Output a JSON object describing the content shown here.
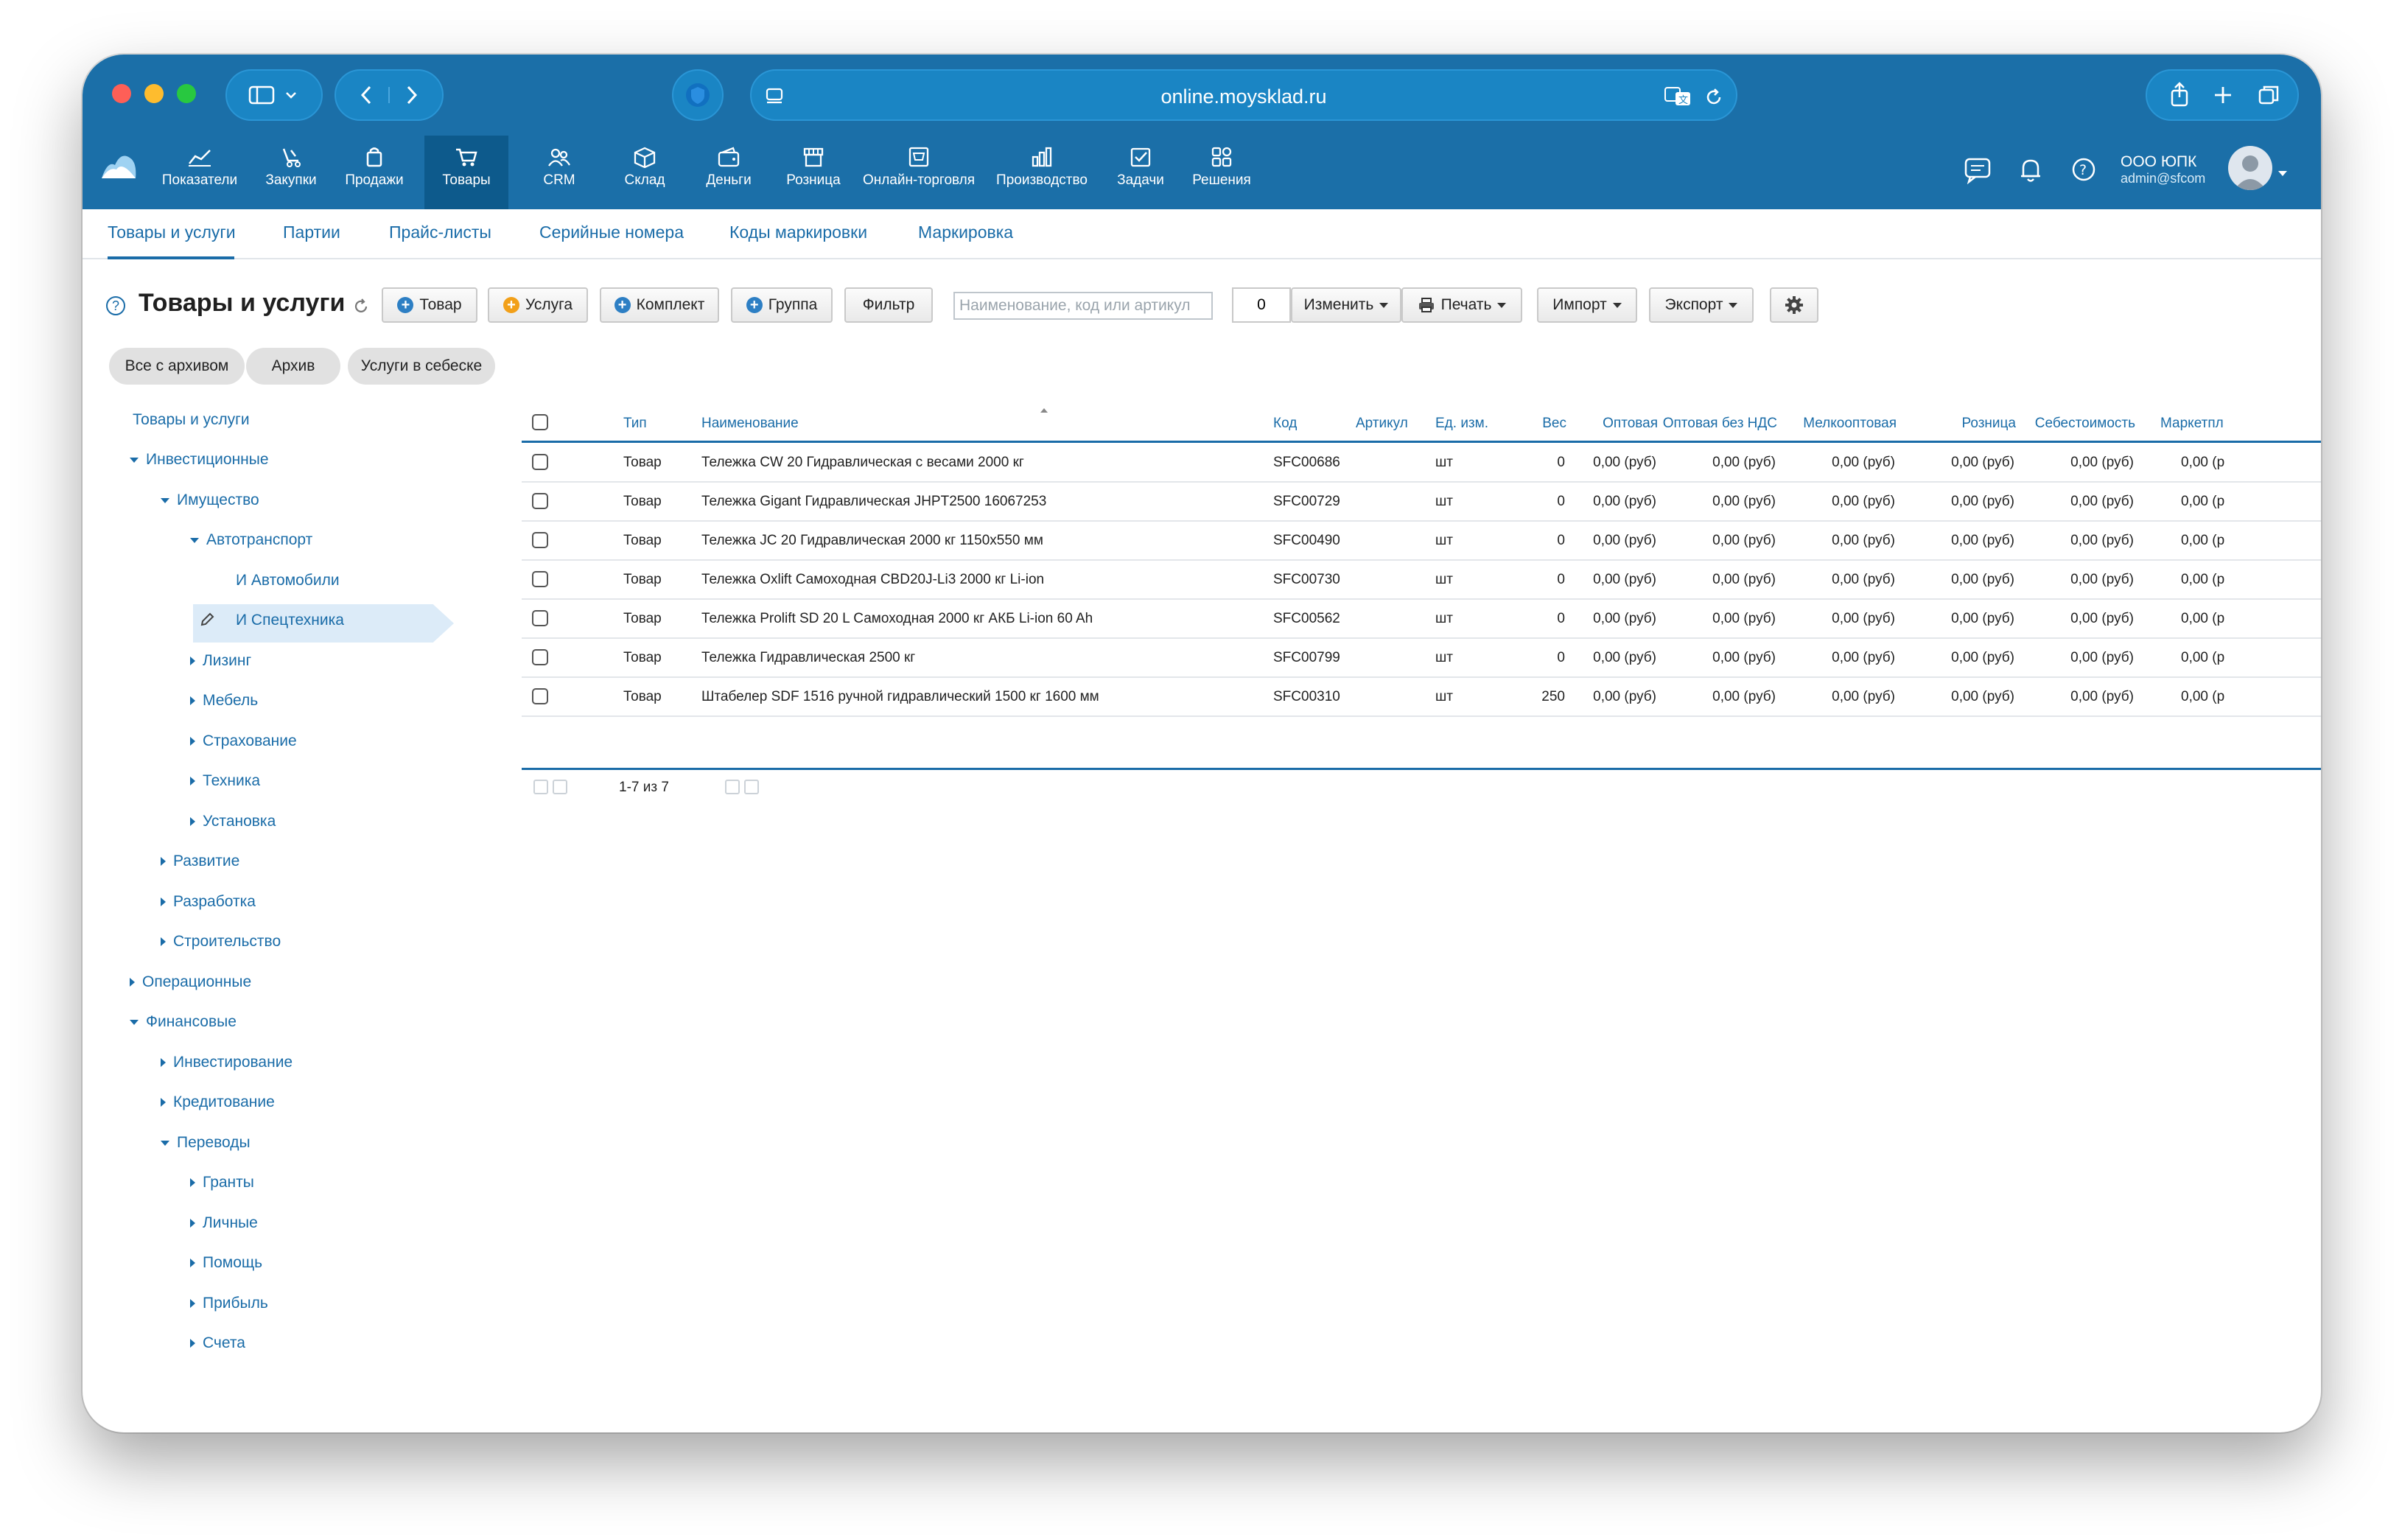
{
  "browser": {
    "url": "online.moysklad.ru"
  },
  "app_nav": {
    "items": [
      {
        "label": "Показатели",
        "icon": "chart-icon"
      },
      {
        "label": "Закупки",
        "icon": "purchase-icon"
      },
      {
        "label": "Продажи",
        "icon": "bag-icon"
      },
      {
        "label": "Товары",
        "icon": "cart-icon"
      },
      {
        "label": "CRM",
        "icon": "people-icon"
      },
      {
        "label": "Склад",
        "icon": "box-icon"
      },
      {
        "label": "Деньги",
        "icon": "wallet-icon"
      },
      {
        "label": "Розница",
        "icon": "store-icon"
      },
      {
        "label": "Онлайн-торговля",
        "icon": "online-store-icon"
      },
      {
        "label": "Производство",
        "icon": "production-icon"
      },
      {
        "label": "Задачи",
        "icon": "tasks-icon"
      },
      {
        "label": "Решения",
        "icon": "apps-icon"
      }
    ],
    "active": "Товары",
    "org_name": "ООО ЮПК",
    "user": "admin@sfcom"
  },
  "subnav": {
    "items": [
      "Товары и услуги",
      "Партии",
      "Прайс-листы",
      "Серийные номера",
      "Коды маркировки",
      "Маркировка"
    ],
    "active": "Товары и услуги"
  },
  "toolbar": {
    "title": "Товары и услуги",
    "product_label": "Товар",
    "service_label": "Услуга",
    "kit_label": "Комплект",
    "group_label": "Группа",
    "filter_label": "Фильтр",
    "search_placeholder": "Наименование, код или артикул",
    "selected_count": "0",
    "edit_label": "Изменить",
    "print_label": "Печать",
    "import_label": "Импорт",
    "export_label": "Экспорт"
  },
  "chips": [
    "Все с архивом",
    "Архив",
    "Услуги в себеске"
  ],
  "tree": {
    "root": "Товары и услуги",
    "items": [
      {
        "label": "Инвестиционные",
        "level": 1,
        "state": "open"
      },
      {
        "label": "Имущество",
        "level": 2,
        "state": "open"
      },
      {
        "label": "Автотранспорт",
        "level": 3,
        "state": "open"
      },
      {
        "label": "И Автомобили",
        "level": 4,
        "state": "leaf"
      },
      {
        "label": "И Спецтехника",
        "level": 4,
        "state": "selected"
      },
      {
        "label": "Лизинг",
        "level": 3,
        "state": "closed"
      },
      {
        "label": "Мебель",
        "level": 3,
        "state": "closed"
      },
      {
        "label": "Страхование",
        "level": 3,
        "state": "closed"
      },
      {
        "label": "Техника",
        "level": 3,
        "state": "closed"
      },
      {
        "label": "Установка",
        "level": 3,
        "state": "closed"
      },
      {
        "label": "Развитие",
        "level": 2,
        "state": "closed"
      },
      {
        "label": "Разработка",
        "level": 2,
        "state": "closed"
      },
      {
        "label": "Строительство",
        "level": 2,
        "state": "closed"
      },
      {
        "label": "Операционные",
        "level": 1,
        "state": "closed"
      },
      {
        "label": "Финансовые",
        "level": 1,
        "state": "open"
      },
      {
        "label": "Инвестирование",
        "level": 2,
        "state": "closed"
      },
      {
        "label": "Кредитование",
        "level": 2,
        "state": "closed"
      },
      {
        "label": "Переводы",
        "level": 2,
        "state": "open"
      },
      {
        "label": "Гранты",
        "level": 3,
        "state": "closed"
      },
      {
        "label": "Личные",
        "level": 3,
        "state": "closed"
      },
      {
        "label": "Помощь",
        "level": 3,
        "state": "closed"
      },
      {
        "label": "Прибыль",
        "level": 3,
        "state": "closed"
      },
      {
        "label": "Счета",
        "level": 3,
        "state": "closed"
      }
    ]
  },
  "table": {
    "columns": [
      "Тип",
      "Наименование",
      "Код",
      "Артикул",
      "Ед. изм.",
      "Вес",
      "Оптовая",
      "Оптовая без НДС",
      "Мелкооптовая",
      "Розница",
      "Себестоимость",
      "Маркетпл"
    ],
    "rows": [
      {
        "type": "Товар",
        "name": "Тележка CW 20 Гидравлическая с весами 2000 кг",
        "code": "SFC00686",
        "article": "",
        "unit": "шт",
        "weight": "0",
        "wholesale": "0,00 (руб)",
        "wholesale_no_vat": "0,00 (руб)",
        "small_wholesale": "0,00 (руб)",
        "retail": "0,00 (руб)",
        "cost": "0,00 (руб)",
        "marketplace": "0,00 (р"
      },
      {
        "type": "Товар",
        "name": "Тележка Gigant Гидравлическая JHPT2500 16067253",
        "code": "SFC00729",
        "article": "",
        "unit": "шт",
        "weight": "0",
        "wholesale": "0,00 (руб)",
        "wholesale_no_vat": "0,00 (руб)",
        "small_wholesale": "0,00 (руб)",
        "retail": "0,00 (руб)",
        "cost": "0,00 (руб)",
        "marketplace": "0,00 (р"
      },
      {
        "type": "Товар",
        "name": "Тележка JC 20 Гидравлическая 2000 кг 1150x550 мм",
        "code": "SFC00490",
        "article": "",
        "unit": "шт",
        "weight": "0",
        "wholesale": "0,00 (руб)",
        "wholesale_no_vat": "0,00 (руб)",
        "small_wholesale": "0,00 (руб)",
        "retail": "0,00 (руб)",
        "cost": "0,00 (руб)",
        "marketplace": "0,00 (р"
      },
      {
        "type": "Товар",
        "name": "Тележка Oxlift Самоходная CBD20J-Li3 2000 кг Li-ion",
        "code": "SFC00730",
        "article": "",
        "unit": "шт",
        "weight": "0",
        "wholesale": "0,00 (руб)",
        "wholesale_no_vat": "0,00 (руб)",
        "small_wholesale": "0,00 (руб)",
        "retail": "0,00 (руб)",
        "cost": "0,00 (руб)",
        "marketplace": "0,00 (р"
      },
      {
        "type": "Товар",
        "name": "Тележка Prolift SD 20 L Самоходная 2000 кг АКБ Li-ion 60 Ah",
        "code": "SFC00562",
        "article": "",
        "unit": "шт",
        "weight": "0",
        "wholesale": "0,00 (руб)",
        "wholesale_no_vat": "0,00 (руб)",
        "small_wholesale": "0,00 (руб)",
        "retail": "0,00 (руб)",
        "cost": "0,00 (руб)",
        "marketplace": "0,00 (р"
      },
      {
        "type": "Товар",
        "name": "Тележка Гидравлическая 2500 кг",
        "code": "SFC00799",
        "article": "",
        "unit": "шт",
        "weight": "0",
        "wholesale": "0,00 (руб)",
        "wholesale_no_vat": "0,00 (руб)",
        "small_wholesale": "0,00 (руб)",
        "retail": "0,00 (руб)",
        "cost": "0,00 (руб)",
        "marketplace": "0,00 (р"
      },
      {
        "type": "Товар",
        "name": "Штабелер SDF 1516 ручной гидравлический 1500 кг 1600 мм",
        "code": "SFC00310",
        "article": "",
        "unit": "шт",
        "weight": "250",
        "wholesale": "0,00 (руб)",
        "wholesale_no_vat": "0,00 (руб)",
        "small_wholesale": "0,00 (руб)",
        "retail": "0,00 (руб)",
        "cost": "0,00 (руб)",
        "marketplace": "0,00 (р"
      }
    ],
    "pagination": "1-7 из 7"
  },
  "colors": {
    "nav_bg": "#1b6fa8",
    "accent": "#1a6ca8",
    "selected_tree": "#dcebf8"
  }
}
